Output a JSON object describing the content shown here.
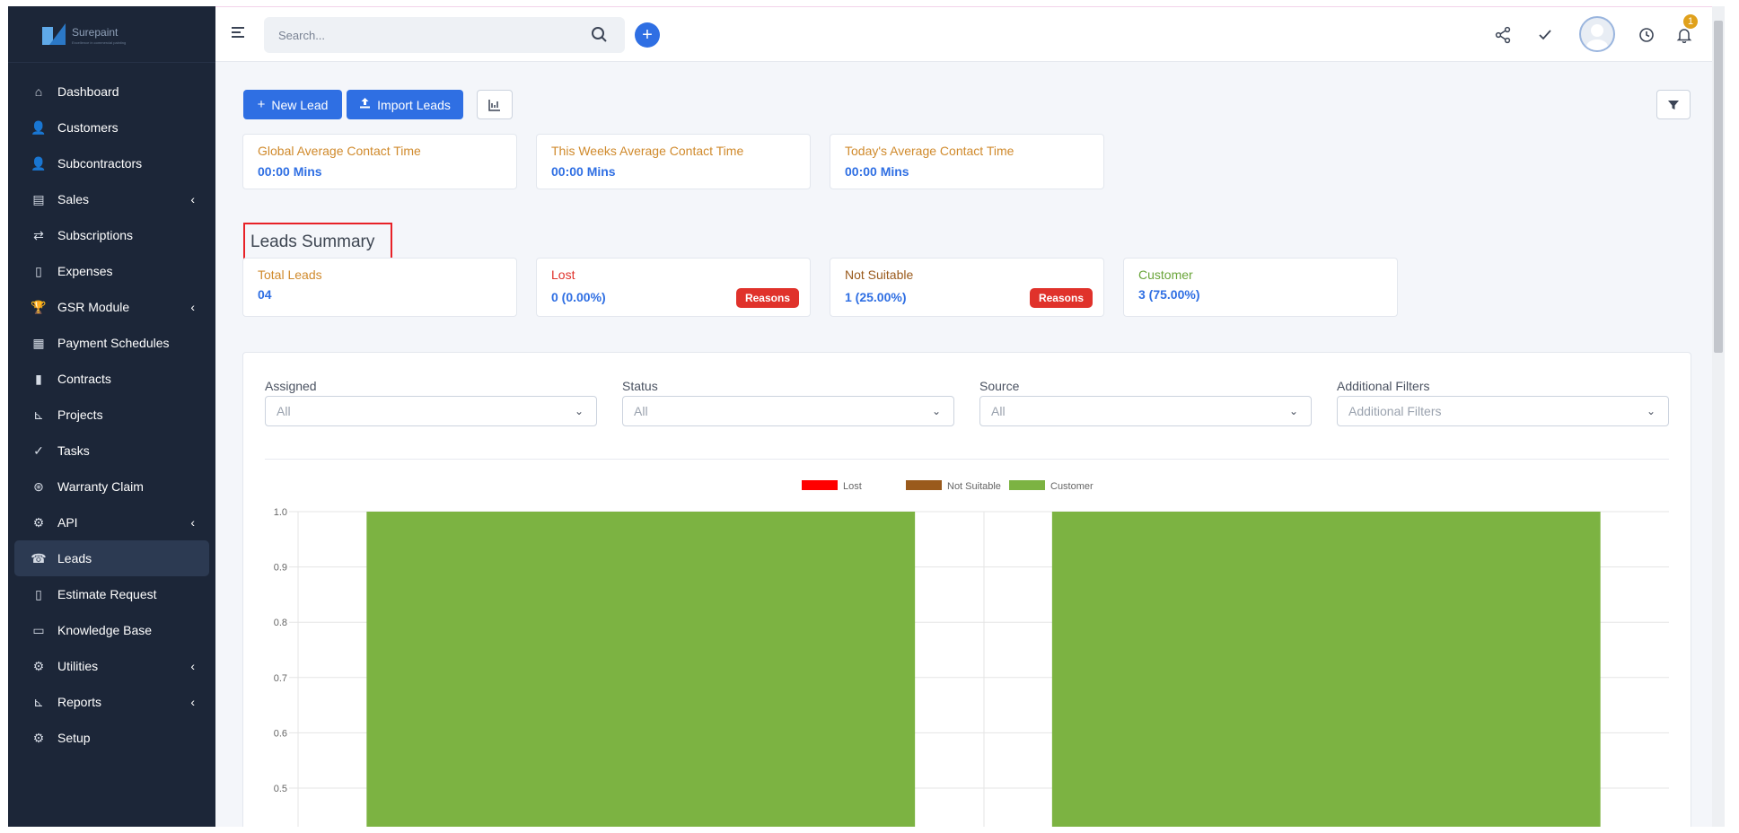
{
  "brand": {
    "name": "Surepaint",
    "tagline": "Excellence in commercial painting"
  },
  "sidebar": {
    "items": [
      {
        "label": "Dashboard",
        "icon": "home-icon",
        "glyph": "⌂",
        "caret": false,
        "active": false
      },
      {
        "label": "Customers",
        "icon": "user-icon",
        "glyph": "👤",
        "caret": false,
        "active": false
      },
      {
        "label": "Subcontractors",
        "icon": "user-tie-icon",
        "glyph": "👤",
        "caret": false,
        "active": false
      },
      {
        "label": "Sales",
        "icon": "receipt-icon",
        "glyph": "▤",
        "caret": true,
        "active": false
      },
      {
        "label": "Subscriptions",
        "icon": "repeat-icon",
        "glyph": "⇄",
        "caret": false,
        "active": false
      },
      {
        "label": "Expenses",
        "icon": "file-icon",
        "glyph": "▯",
        "caret": false,
        "active": false
      },
      {
        "label": "GSR Module",
        "icon": "trophy-icon",
        "glyph": "🏆",
        "caret": true,
        "active": false
      },
      {
        "label": "Payment Schedules",
        "icon": "calendar-icon",
        "glyph": "▦",
        "caret": false,
        "active": false
      },
      {
        "label": "Contracts",
        "icon": "contract-icon",
        "glyph": "▮",
        "caret": false,
        "active": false
      },
      {
        "label": "Projects",
        "icon": "chart-icon",
        "glyph": "⊾",
        "caret": false,
        "active": false
      },
      {
        "label": "Tasks",
        "icon": "check-circle-icon",
        "glyph": "✓",
        "caret": false,
        "active": false
      },
      {
        "label": "Warranty Claim",
        "icon": "lifebuoy-icon",
        "glyph": "⊛",
        "caret": false,
        "active": false
      },
      {
        "label": "API",
        "icon": "cogs-icon",
        "glyph": "⚙",
        "caret": true,
        "active": false
      },
      {
        "label": "Leads",
        "icon": "tty-icon",
        "glyph": "☎",
        "caret": false,
        "active": true
      },
      {
        "label": "Estimate Request",
        "icon": "document-icon",
        "glyph": "▯",
        "caret": false,
        "active": false
      },
      {
        "label": "Knowledge Base",
        "icon": "folder-icon",
        "glyph": "▭",
        "caret": false,
        "active": false
      },
      {
        "label": "Utilities",
        "icon": "cogs-icon",
        "glyph": "⚙",
        "caret": true,
        "active": false
      },
      {
        "label": "Reports",
        "icon": "chart-area-icon",
        "glyph": "⊾",
        "caret": true,
        "active": false
      },
      {
        "label": "Setup",
        "icon": "gear-icon",
        "glyph": "⚙",
        "caret": false,
        "active": false
      }
    ]
  },
  "topbar": {
    "search_placeholder": "Search...",
    "notification_count": "1"
  },
  "toolbar": {
    "new_lead": "New Lead",
    "import_leads": "Import Leads"
  },
  "contact_times": [
    {
      "title": "Global Average Contact Time",
      "value": "00:00 Mins"
    },
    {
      "title": "This Weeks Average Contact Time",
      "value": "00:00 Mins"
    },
    {
      "title": "Today's Average Contact Time",
      "value": "00:00 Mins"
    }
  ],
  "summary": {
    "title": "Leads Summary",
    "total": {
      "title": "Total Leads",
      "value": "04"
    },
    "lost": {
      "title": "Lost",
      "value": "0 (0.00%)",
      "action": "Reasons"
    },
    "not_suitable": {
      "title": "Not Suitable",
      "value": "1 (25.00%)",
      "action": "Reasons"
    },
    "customer": {
      "title": "Customer",
      "value": "3 (75.00%)"
    }
  },
  "filters": {
    "assigned": {
      "label": "Assigned",
      "value": "All"
    },
    "status": {
      "label": "Status",
      "value": "All"
    },
    "source": {
      "label": "Source",
      "value": "All"
    },
    "additional": {
      "label": "Additional Filters",
      "placeholder": "Additional Filters"
    }
  },
  "colors": {
    "accent": "#2f6fe3",
    "lost": "#ff0000",
    "not_suitable": "#9a5a1c",
    "customer": "#7cb342",
    "sidebar": "#1c2638"
  },
  "chart_data": {
    "type": "bar",
    "stacked": true,
    "categories": [
      "",
      ""
    ],
    "series": [
      {
        "name": "Lost",
        "color": "#ff0000",
        "values": [
          0,
          0
        ]
      },
      {
        "name": "Not Suitable",
        "color": "#9a5a1c",
        "values": [
          0,
          0
        ]
      },
      {
        "name": "Customer",
        "color": "#7cb342",
        "values": [
          1,
          1
        ]
      }
    ],
    "y_ticks": [
      "1.0",
      "0.9",
      "0.8",
      "0.7",
      "0.6",
      "0.5"
    ],
    "ylim": [
      0,
      1
    ],
    "legend": "top-center",
    "grid": true
  }
}
